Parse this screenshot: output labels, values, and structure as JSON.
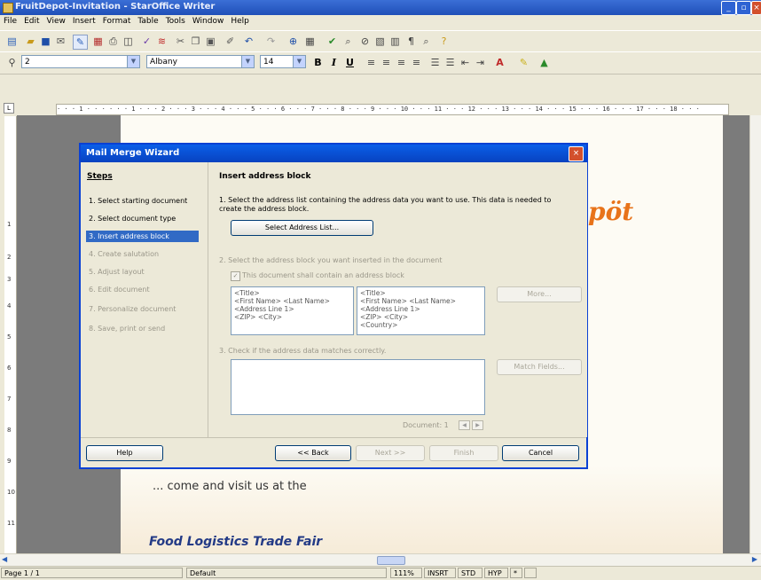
{
  "window": {
    "title": "FruitDepot-Invitation - StarOffice Writer"
  },
  "menu": [
    "File",
    "Edit",
    "View",
    "Insert",
    "Format",
    "Table",
    "Tools",
    "Window",
    "Help"
  ],
  "format_bar": {
    "style": "2",
    "font": "Albany",
    "size": "14",
    "bold": "B",
    "italic": "I",
    "underline": "U"
  },
  "ruler": {
    "scale": "· · · 1 · · ·   · · · 1 · · · 2 · · · 3 · · · 4 · · · 5 · · · 6 · · · 7 · · · 8 · · · 9 · · · 10 · · · 11 · · · 12 · · · 13 · · · 14 · · · 15 · · · 16 · · · 17 · · · 18 · · ·"
  },
  "vruler": [
    "1",
    "2",
    "3",
    "4",
    "5",
    "6",
    "7",
    "8",
    "9",
    "10",
    "11"
  ],
  "document": {
    "logo": "pöt",
    "come": "... come and visit us at the",
    "fair": "Food Logistics Trade Fair"
  },
  "dialog": {
    "title": "Mail Merge Wizard",
    "steps_title": "Steps",
    "steps": [
      "1. Select starting document",
      "2. Select document type",
      "3. Insert address block",
      "4. Create salutation",
      "5. Adjust layout",
      "6. Edit document",
      "7. Personalize document",
      "8. Save, print or send"
    ],
    "heading": "Insert address block",
    "instr1": "1. Select the address list containing the address data you want to use. This data is needed to create the address block.",
    "select_list_btn": "Select Address List...",
    "instr2": "2. Select the address block you want inserted in the document",
    "checkbox_label": "This document shall contain an address block",
    "block1": [
      "<Title>",
      "<First Name> <Last Name>",
      "<Address Line 1>",
      "<ZIP> <City>"
    ],
    "block2": [
      "<Title>",
      "<First Name> <Last Name>",
      "<Address Line 1>",
      "<ZIP> <City>",
      "<Country>"
    ],
    "more_btn": "More...",
    "instr3": "3. Check if the address data matches correctly.",
    "match_btn": "Match Fields...",
    "doc_counter": "Document: 1",
    "help_btn": "Help",
    "back_btn": "<< Back",
    "next_btn": "Next >>",
    "finish_btn": "Finish",
    "cancel_btn": "Cancel"
  },
  "status": {
    "page": "Page 1 / 1",
    "style": "Default",
    "zoom": "111%",
    "insert": "INSRT",
    "std": "STD",
    "hyp": "HYP",
    "star": "*"
  }
}
